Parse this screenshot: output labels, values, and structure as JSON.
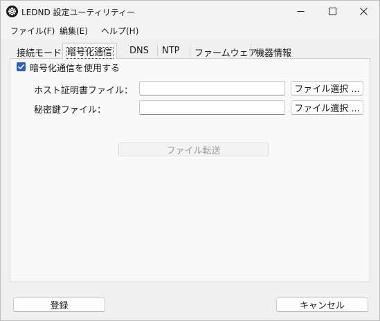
{
  "window": {
    "title": "LEDND 設定ユーティリティー",
    "icon": "app-gear-icon",
    "controls": [
      "minimize-icon",
      "maximize-icon",
      "close-icon"
    ]
  },
  "menu": {
    "file": "ファイル(F)",
    "edit": "編集(E)",
    "help": "ヘルプ(H)"
  },
  "tabs": [
    {
      "label": "接続モード",
      "active": false
    },
    {
      "label": "暗号化通信",
      "active": true
    },
    {
      "label": "DNS",
      "active": false
    },
    {
      "label": "NTP",
      "active": false
    },
    {
      "label": "ファームウェア",
      "active": false
    },
    {
      "label": "機器情報",
      "active": false
    }
  ],
  "encryption": {
    "enable_label": "暗号化通信を使用する",
    "enable_checked": true,
    "host_cert_label": "ホスト証明書ファイル：",
    "host_cert_value": "",
    "secret_key_label": "秘密鍵ファイル：",
    "secret_key_value": "",
    "select_file_label": "ファイル選択 ...",
    "transfer_label": "ファイル転送",
    "transfer_enabled": false
  },
  "footer": {
    "register_label": "登録",
    "cancel_label": "キャンセル"
  },
  "colors": {
    "accent": "#2b62c0",
    "window_bg": "#f0f0f0",
    "panel_bg": "#f9f9f9"
  }
}
